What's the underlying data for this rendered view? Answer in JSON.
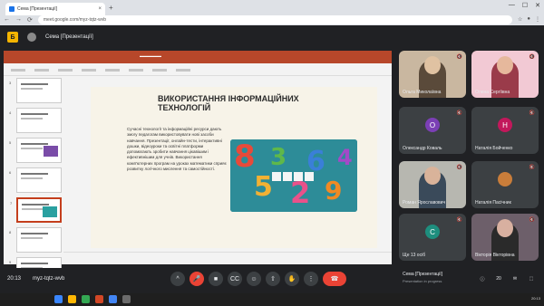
{
  "browser": {
    "tab_title": "Сема [Презентації]",
    "url": "meet.google.com/myz-tqtz-wvb",
    "new_tab": "+",
    "nav_back": "←",
    "nav_forward": "→",
    "nav_reload": "⟳",
    "tab_close": "×",
    "min": "—",
    "max": "☐",
    "close": "✕"
  },
  "meeting": {
    "logo": "Б",
    "title": "Сема [Презентації]",
    "time": "20:13",
    "code": "myz-tqtz-wvb",
    "presenter_name": "Сема [Презентації]",
    "presenter_sub": "Presentation in progress"
  },
  "slide": {
    "title": "ВИКОРИСТАННЯ ІНФОРМАЦІЙНИХ ТЕХНОЛОГІЙ",
    "body": "Сучасні технології та інформаційні ресурси дають змогу педагогам використовувати нові засоби навчання. Презентації, онлайн-тести, інтерактивні дошки, відеоуроки та освітні платформи допомагають зробити навчання цікавішим і ефективнішим для учнів. Використання комп'ютерних програм на уроках математики сприяє розвитку логічного мислення та самостійності."
  },
  "thumbs": [
    "3",
    "4",
    "5",
    "6",
    "7",
    "8",
    "9"
  ],
  "participants": [
    {
      "name": "Ольга Миколаївна",
      "type": "video",
      "bg": "#c9b7a0",
      "head": "#e0c2a2",
      "body": "#5a4a3a"
    },
    {
      "name": "Олена Сергіївна",
      "type": "video",
      "bg": "#f2c9d4",
      "head": "#e6b89c",
      "body": "#9a3b4a"
    },
    {
      "name": "Олександр Коваль",
      "type": "initial",
      "initial": "О",
      "color": "#7b3fb5"
    },
    {
      "name": "Наталія Бойченко",
      "type": "initial",
      "initial": "Н",
      "color": "#c2185b"
    },
    {
      "name": "Роман Ярославович",
      "type": "video",
      "bg": "#b7b7b0",
      "head": "#d9b39a",
      "body": "#3a4a5a"
    },
    {
      "name": "Наталія Пасічник",
      "type": "avatar",
      "color": "#c97d3a"
    },
    {
      "name": "Ще 13 осіб",
      "type": "more",
      "initial": "С",
      "color": "#1e8e7e"
    },
    {
      "name": "Вікторія Вікторівна",
      "type": "video",
      "bg": "#6d5f6a",
      "head": "#d8b0a0",
      "body": "#2a2a2a"
    }
  ],
  "controls": {
    "expand": "^",
    "mic": "🎤",
    "cam": "■",
    "captions": "CC",
    "emoji": "☺",
    "present": "⇧",
    "raise": "✋",
    "more": "⋮",
    "end": "☎",
    "info": "ⓘ",
    "people": "20",
    "chat": "✉",
    "activities": "⬚"
  },
  "taskbar": {
    "clock": "20:13"
  }
}
